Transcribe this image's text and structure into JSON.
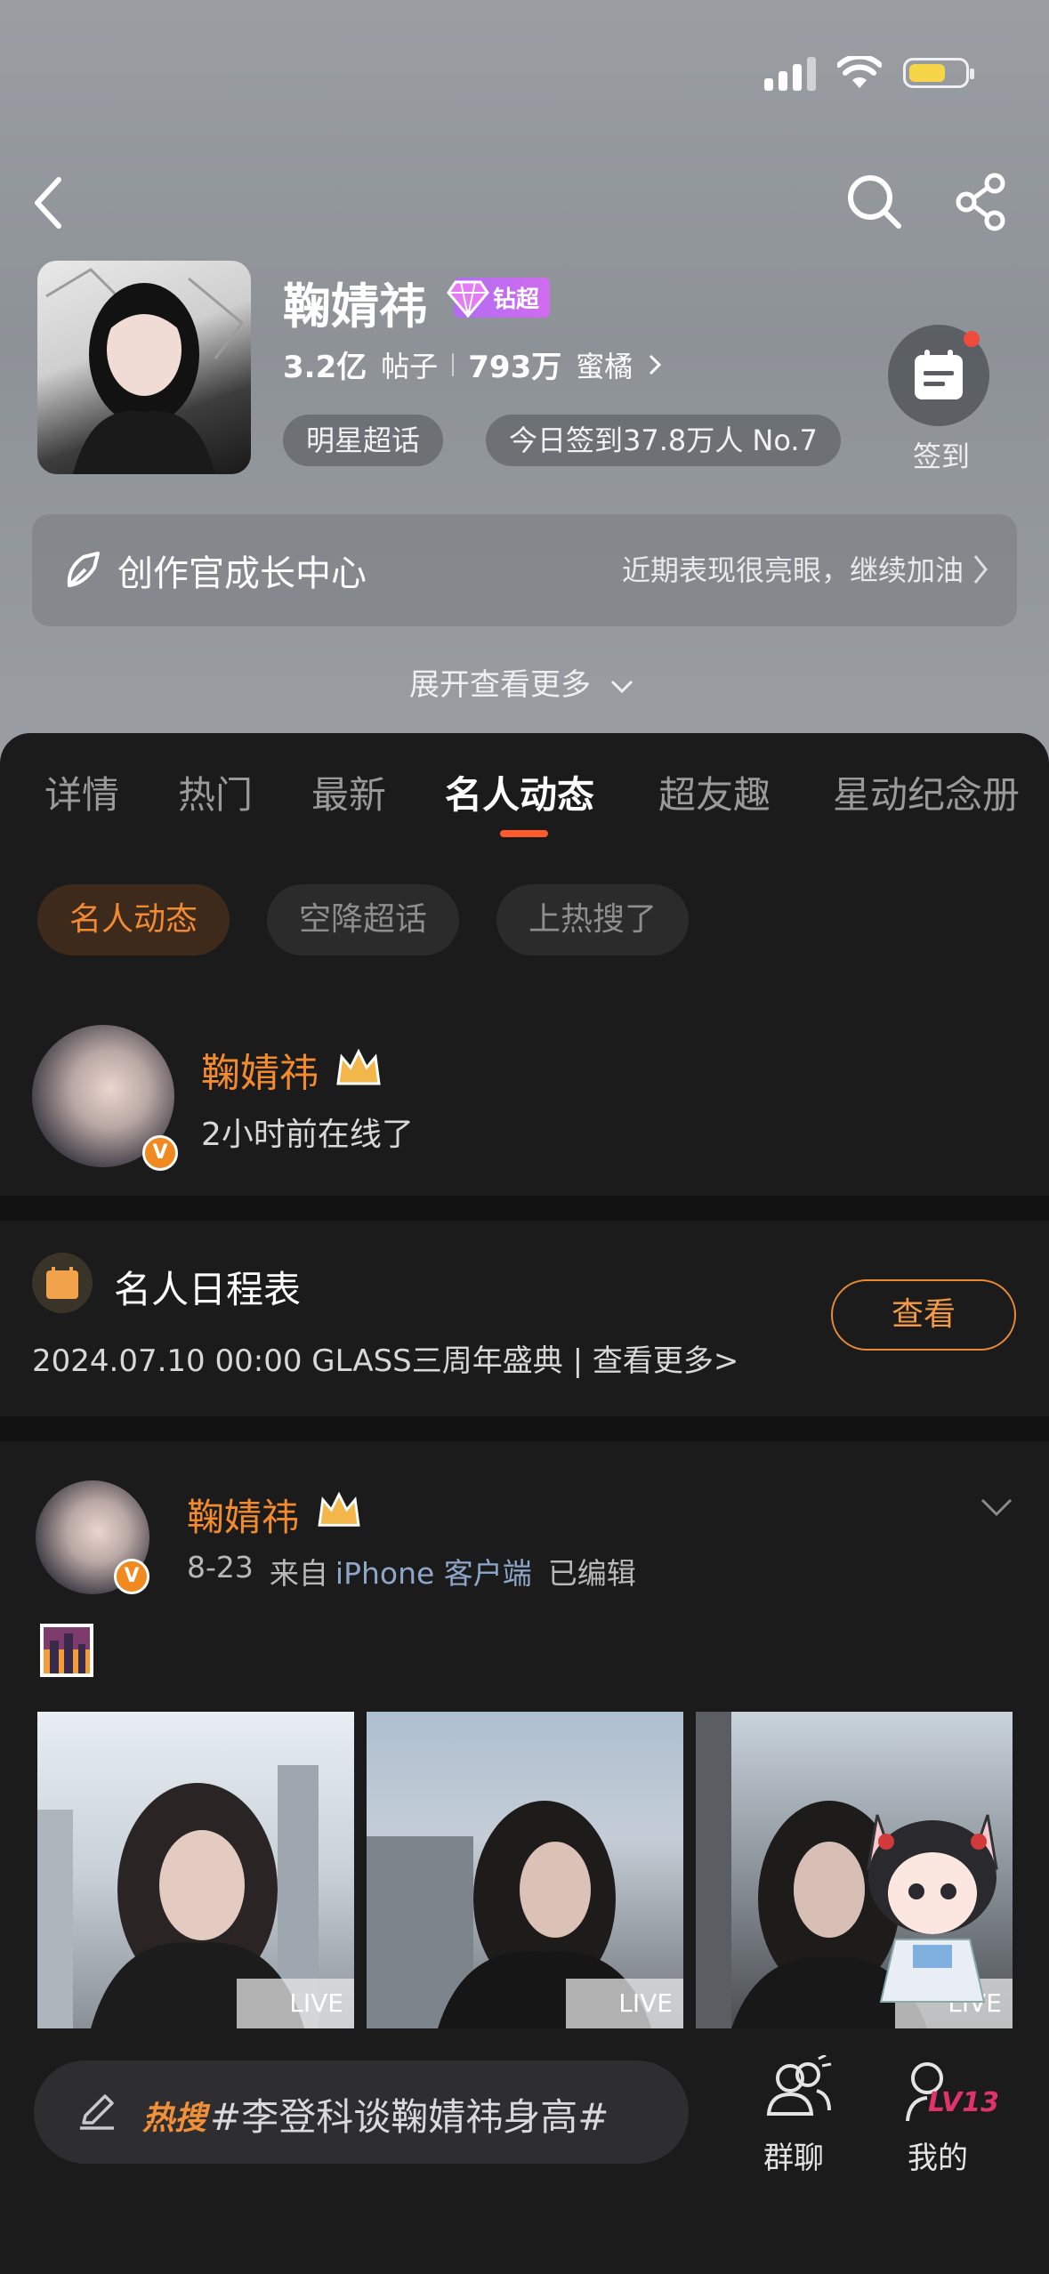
{
  "header": {
    "title": "鞠婧祎",
    "super_badge": "钻超",
    "posts_count": "3.2亿",
    "posts_label": "帖子",
    "fans_count": "793万",
    "fans_label": "蜜橘",
    "chip_category": "明星超话",
    "chip_checkin": "今日签到37.8万人 No.7",
    "checkin_label": "签到",
    "creator_title": "创作官成长中心",
    "creator_subtitle": "近期表现很亮眼，继续加油",
    "expand_label": "展开查看更多"
  },
  "tabs": [
    "详情",
    "热门",
    "最新",
    "名人动态",
    "超友趣",
    "星动纪念册"
  ],
  "active_tab": "名人动态",
  "filters": [
    "名人动态",
    "空降超话",
    "上热搜了"
  ],
  "online": {
    "name": "鞠婧祎",
    "status": "2小时前在线了"
  },
  "schedule": {
    "title": "名人日程表",
    "detail": "2024.07.10 00:00 GLASS三周年盛典 |  查看更多>",
    "button": "查看"
  },
  "post": {
    "author": "鞠婧祎",
    "date": "8-23",
    "source_prefix": "来自",
    "source": "iPhone 客户端",
    "edited": "已编辑",
    "images": [
      {
        "tag": "LIVE"
      },
      {
        "tag": "LIVE"
      },
      {
        "tag": "LIVE"
      }
    ]
  },
  "bottom_bar": {
    "hot_label": "热搜",
    "hot_topic": "#李登科谈鞠婧祎身高#",
    "group_chat": "群聊",
    "mine": "我的",
    "level": "LV13"
  },
  "colors": {
    "accent_orange": "#f28a2e",
    "tab_indicator": "#ff5a2b",
    "diamond_purple": "#c06cf2",
    "notification_red": "#f04a3c"
  }
}
